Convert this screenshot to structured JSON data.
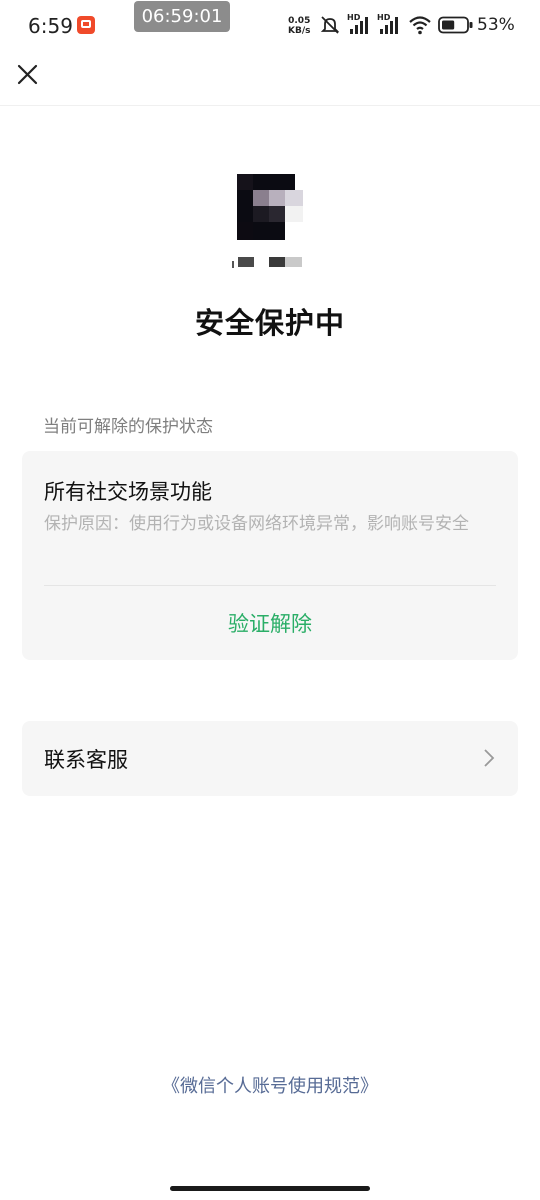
{
  "status_bar": {
    "time": "6:59",
    "recording_time": "06:59:01",
    "network_speed_value": "0.05",
    "network_speed_unit": "KB/s",
    "signal1_label": "HD",
    "signal2_label": "HD",
    "battery_percent": "53%",
    "battery_level": 0.53
  },
  "nav": {
    "close_icon": "close-icon"
  },
  "profile": {
    "title": "安全保护中"
  },
  "protection": {
    "section_label": "当前可解除的保护状态",
    "card_title": "所有社交场景功能",
    "reason": "保护原因：使用行为或设备网络环境异常，影响账号安全",
    "verify_button": "验证解除"
  },
  "service": {
    "label": "联系客服"
  },
  "footer": {
    "link": "《微信个人账号使用规范》"
  },
  "colors": {
    "accent_green": "#2aae67",
    "link_blue": "#576b95",
    "card_bg": "#f6f6f6"
  }
}
